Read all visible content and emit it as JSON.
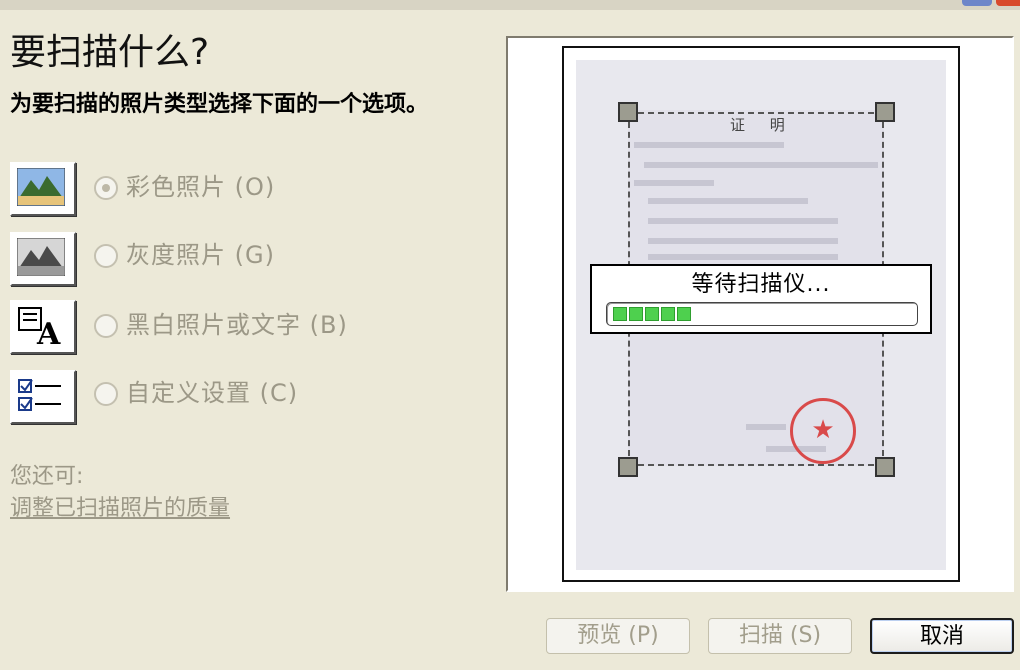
{
  "header": {
    "title": "要扫描什么?",
    "subtitle": "为要扫描的照片类型选择下面的一个选项。"
  },
  "options": [
    {
      "label": "彩色照片 (O)",
      "icon": "color-photo-icon",
      "selected": true
    },
    {
      "label": "灰度照片 (G)",
      "icon": "grayscale-photo-icon",
      "selected": false
    },
    {
      "label": "黑白照片或文字 (B)",
      "icon": "black-white-text-icon",
      "selected": false
    },
    {
      "label": "自定义设置 (C)",
      "icon": "custom-settings-icon",
      "selected": false
    }
  ],
  "extras": {
    "also_label": "您还可:",
    "adjust_link": "调整已扫描照片的质量"
  },
  "preview": {
    "document_title": "证 明",
    "stamp_text": "",
    "waiting_text": "等待扫描仪...",
    "progress_segments": 5
  },
  "buttons": {
    "preview": "预览 (P)",
    "scan": "扫描 (S)",
    "cancel": "取消"
  },
  "colors": {
    "dialog_bg": "#ece9d8",
    "disabled_text": "#9c9887",
    "progress": "#4ed04e",
    "seal": "#d94a4a"
  }
}
